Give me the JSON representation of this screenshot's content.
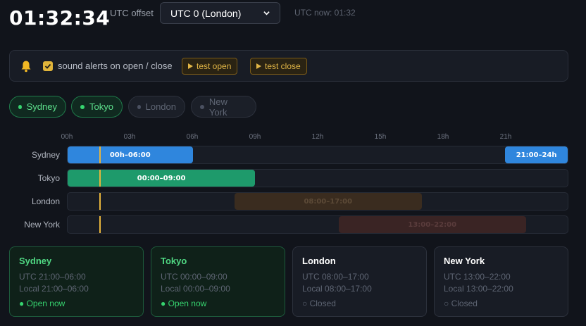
{
  "clock": "01:32:34",
  "offset": {
    "label": "UTC offset",
    "selected": "UTC 0 (London)"
  },
  "utc_now": "UTC now: 01:32",
  "alerts": {
    "label": "sound alerts on open / close",
    "checked": true,
    "test_open": "test open",
    "test_close": "test close",
    "accent": "#e2b646"
  },
  "filters": [
    {
      "label": "Sydney",
      "active": true
    },
    {
      "label": "Tokyo",
      "active": true
    },
    {
      "label": "London",
      "active": false
    },
    {
      "label": "New York",
      "active": false
    }
  ],
  "hours": [
    "00h",
    "03h",
    "06h",
    "09h",
    "12h",
    "15h",
    "18h",
    "21h"
  ],
  "current_utc_hour": 1.5428,
  "timeline": [
    {
      "name": "Sydney",
      "color": "#2f86dd",
      "segments": [
        {
          "start": 0,
          "end": 6,
          "label": "00h–06:00"
        },
        {
          "start": 21,
          "end": 24,
          "label": "21:00–24h"
        }
      ]
    },
    {
      "name": "Tokyo",
      "color": "#1e9a6b",
      "segments": [
        {
          "start": 0,
          "end": 9,
          "label": "00:00–09:00"
        }
      ]
    },
    {
      "name": "London",
      "color": "#3a2c1f",
      "segments": [
        {
          "start": 8,
          "end": 17,
          "label": "08:00–17:00"
        }
      ]
    },
    {
      "name": "New York",
      "color": "#3a2424",
      "segments": [
        {
          "start": 13,
          "end": 22,
          "label": "13:00–22:00"
        }
      ]
    }
  ],
  "cards": [
    {
      "title": "Sydney",
      "utc": "UTC 21:00–06:00",
      "local": "Local 21:00–06:00",
      "status": "● Open now",
      "open": true
    },
    {
      "title": "Tokyo",
      "utc": "UTC 00:00–09:00",
      "local": "Local 00:00–09:00",
      "status": "● Open now",
      "open": true
    },
    {
      "title": "London",
      "utc": "UTC 08:00–17:00",
      "local": "Local 08:00–17:00",
      "status": "○ Closed",
      "open": false
    },
    {
      "title": "New York",
      "utc": "UTC 13:00–22:00",
      "local": "Local 13:00–22:00",
      "status": "○ Closed",
      "open": false
    }
  ]
}
